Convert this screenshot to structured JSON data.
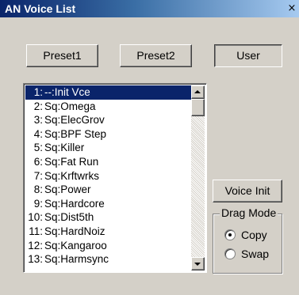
{
  "window": {
    "title": "AN Voice List",
    "close_glyph": "×"
  },
  "buttons": {
    "preset1": "Preset1",
    "preset2": "Preset2",
    "user": "User",
    "voice_init": "Voice Init"
  },
  "voice_list": {
    "selected_index": 0,
    "items": [
      {
        "num": "1:",
        "name": "--:Init Vce"
      },
      {
        "num": "2:",
        "name": "Sq:Omega"
      },
      {
        "num": "3:",
        "name": "Sq:ElecGrov"
      },
      {
        "num": "4:",
        "name": "Sq:BPF Step"
      },
      {
        "num": "5:",
        "name": "Sq:Killer"
      },
      {
        "num": "6:",
        "name": "Sq:Fat Run"
      },
      {
        "num": "7:",
        "name": "Sq:Krftwrks"
      },
      {
        "num": "8:",
        "name": "Sq:Power"
      },
      {
        "num": "9:",
        "name": "Sq:Hardcore"
      },
      {
        "num": "10:",
        "name": "Sq:Dist5th"
      },
      {
        "num": "11:",
        "name": "Sq:HardNoiz"
      },
      {
        "num": "12:",
        "name": "Sq:Kangaroo"
      },
      {
        "num": "13:",
        "name": "Sq:Harmsync"
      }
    ]
  },
  "drag_mode": {
    "label": "Drag Mode",
    "options": [
      "Copy",
      "Swap"
    ],
    "selected": "Copy"
  },
  "colors": {
    "face": "#d4d0c8",
    "titlebar": "#0a246a",
    "selection": "#0a246a"
  }
}
